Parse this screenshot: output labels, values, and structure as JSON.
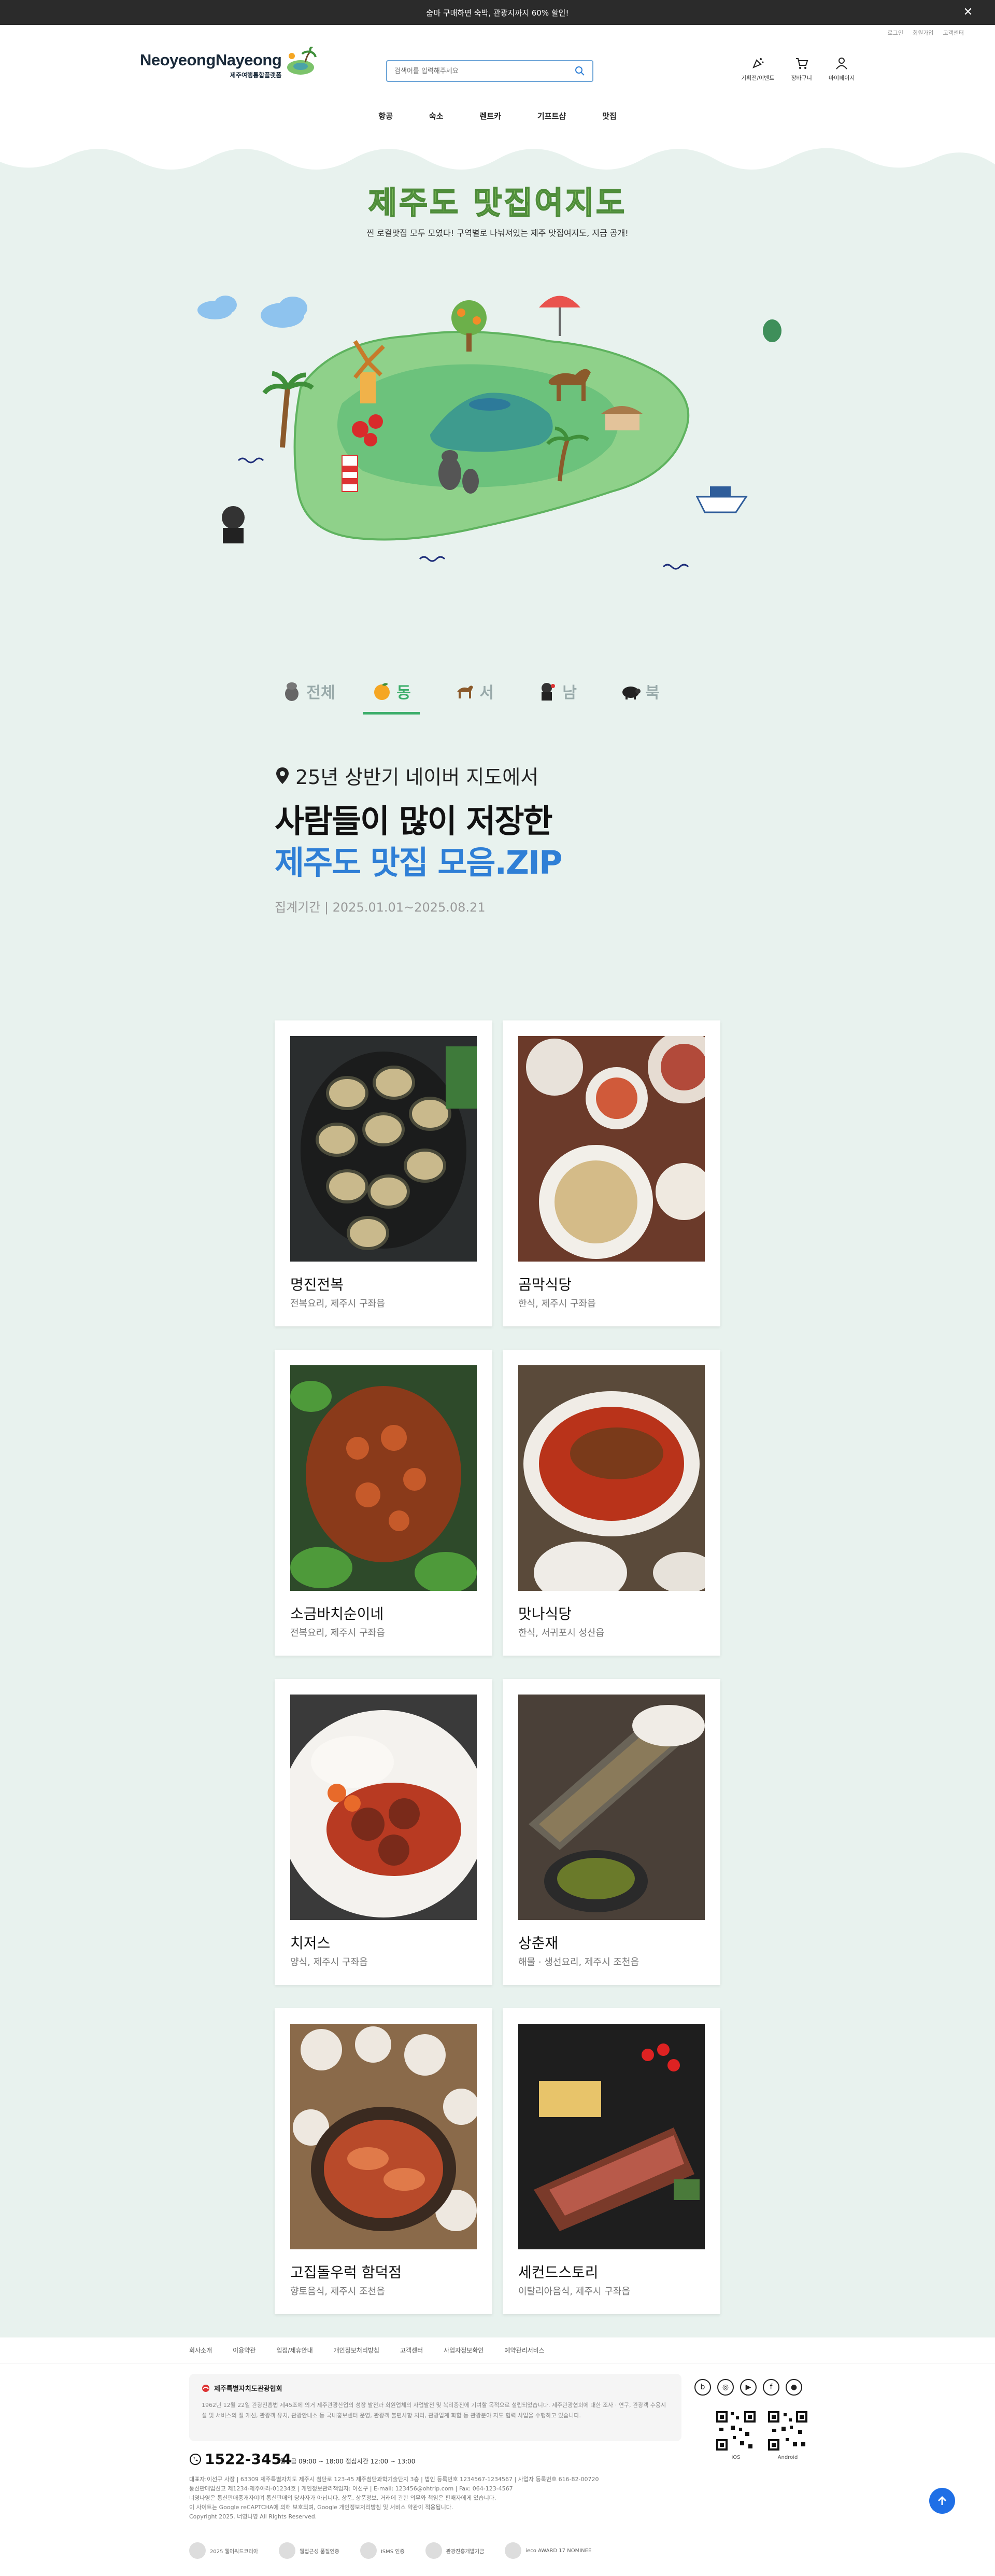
{
  "banner": {
    "text": "숨마 구매하면 숙박, 관광지까지 60% 할인!",
    "close": "✕"
  },
  "util": [
    "로그인",
    "회원가입",
    "고객센터"
  ],
  "header": {
    "logo": "NeoyeongNayeong",
    "logo_sub": "제주여행통합플랫폼",
    "search_placeholder": "검색어를 입력해주세요",
    "icons": [
      {
        "label": "기획전/이벤트"
      },
      {
        "label": "장바구니"
      },
      {
        "label": "마이페이지"
      }
    ]
  },
  "gnb": [
    "항공",
    "숙소",
    "렌트카",
    "기프트샵",
    "맛집"
  ],
  "hero": {
    "title": "제주도 맛집여지도",
    "subtitle": "찐 로컬맛집 모두 모였다! 구역별로 나눠져있는 제주 맛집여지도, 지금 공개!"
  },
  "tabs": [
    {
      "label": "전체",
      "active": false
    },
    {
      "label": "동",
      "active": true
    },
    {
      "label": "서",
      "active": false
    },
    {
      "label": "남",
      "active": false
    },
    {
      "label": "북",
      "active": false
    }
  ],
  "intro": {
    "location": "25년 상반기 네이버 지도에서",
    "line1": "사람들이 많이 저장한",
    "line2": "제주도 맛집 모음.ZIP",
    "period": "집계기간 | 2025.01.01~2025.08.21"
  },
  "cards": [
    {
      "name": "명진전복",
      "cat": "전복요리, 제주시 구좌읍"
    },
    {
      "name": "곰막식당",
      "cat": "한식, 제주시 구좌읍"
    },
    {
      "name": "소금바치순이네",
      "cat": "전복요리, 제주시 구좌읍"
    },
    {
      "name": "맛나식당",
      "cat": "한식, 서귀포시 성산읍"
    },
    {
      "name": "치저스",
      "cat": "양식, 제주시 구좌읍"
    },
    {
      "name": "상춘재",
      "cat": "해물 · 생선요리, 제주시 조천읍"
    },
    {
      "name": "고집돌우럭 함덕점",
      "cat": "향토음식, 제주시 조천읍"
    },
    {
      "name": "세컨드스토리",
      "cat": "이탈리아음식, 제주시 구좌읍"
    }
  ],
  "footer": {
    "links": [
      "회사소개",
      "이용약관",
      "입점/제휴안내",
      "개인정보처리방침",
      "고객센터",
      "사업자정보확인",
      "예약관리서비스"
    ],
    "notice_title": "제주특별자치도관광협회",
    "notice_body": "1962년 12월 22일 관광진흥법 제45조에 의거 제주관광산업의 성장 발전과 회원업체의 사업발전 및 복리증진에 기여할 목적으로 설립되었습니다. 제주관광협회에 대한 조사 · 연구, 관광객 수용시설 및 서비스의 질 개선, 관광객 유치, 관광안내소 등 국내홍보센터 운영, 관광객 불편사항 처리, 관광업계 화합 등 관광분야 지도 협력 사업을 수행하고 있습니다.",
    "socials": [
      "blog",
      "instagram",
      "youtube",
      "facebook",
      "talk"
    ],
    "qr": [
      "iOS",
      "Android"
    ],
    "tel": "1522-3454",
    "hours": "월~금 09:00 ~ 18:00    점심시간 12:00 ~ 13:00",
    "info": [
      "대표자:이선구 사장 | 63309 제주특별자치도 제주시 첨단로 123-45 제주첨단과학기술단지 3층 | 법인 등록번호 1234567-1234567 | 사업자 등록번호 616-82-00720",
      "통신판매업신고 제1234-제주아라-01234호 | 개인정보관리책임자: 이선구 | E-mail: 123456@ohtrip.com | Fax: 064-123-4567",
      "너영나영은 통신판매중개자이며 통신판매의 당사자가 아닙니다. 상품, 상품정보, 거래에 관한 의무와 책임은 판매자에게 있습니다.",
      "이 사이트는 Google reCAPTCHA에 의해 보호되며, Google 개인정보처리방침 및 서비스 약관이 적용됩니다.",
      "Copyright 2025. 너영나영 All Rights Reserved."
    ],
    "awards": [
      "2025 웹어워드코리아",
      "웹접근성 품질인증",
      "ISMS 인증",
      "관광진흥개발기금",
      "ieco AWARD 17 NOMINEE"
    ]
  },
  "colors": {
    "accent": "#3cae6a",
    "blue": "#2f7fd6",
    "bg": "#e8f2ee"
  }
}
